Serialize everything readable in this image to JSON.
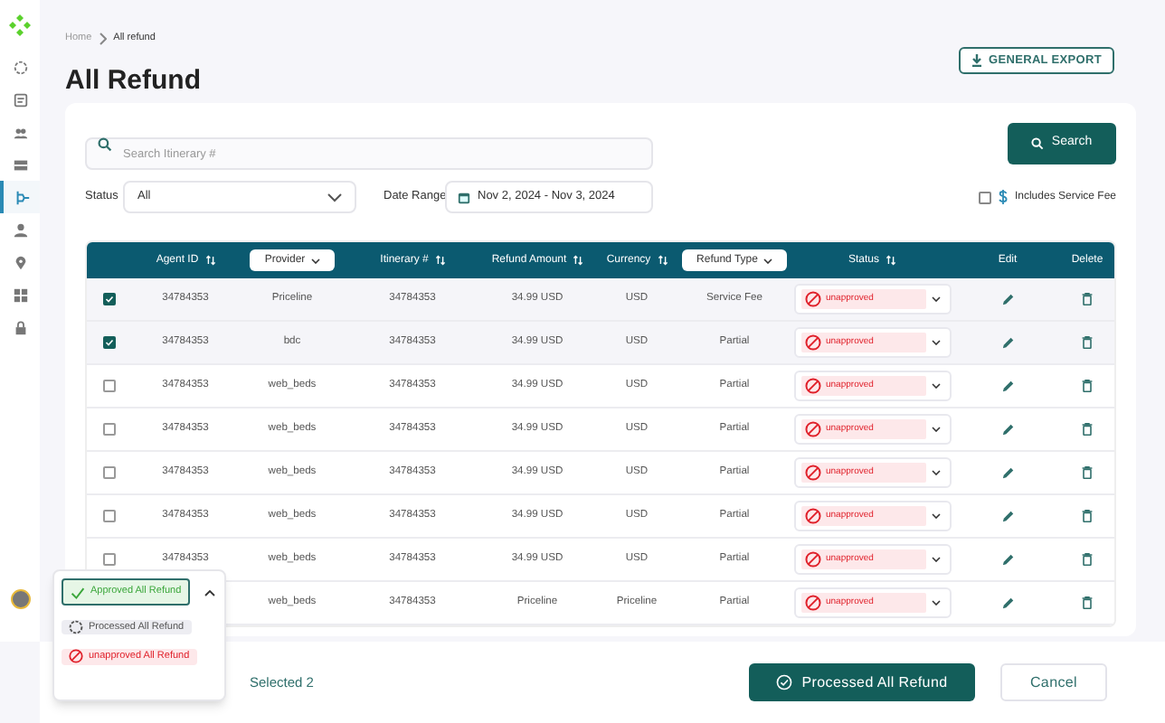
{
  "sidebar": {
    "items": [
      {
        "selected": false
      },
      {
        "selected": false
      },
      {
        "selected": false
      },
      {
        "selected": false
      },
      {
        "selected": true
      },
      {
        "selected": false
      },
      {
        "selected": false
      },
      {
        "selected": false
      },
      {
        "selected": false
      }
    ]
  },
  "breadcrumb": [
    {
      "label": "Home"
    },
    {
      "label": "All refund"
    }
  ],
  "page_title": "All Refund",
  "export_button": "GENERAL EXPORT",
  "filters": {
    "search": {
      "placeholder": "Search Itinerary #"
    },
    "search_button": "Search",
    "status_label": "Status",
    "status_value": "All",
    "date_label": "Date Range",
    "date_value": "Nov 2, 2024 - Nov 3, 2024",
    "service_fee": {
      "label": "Includes Service Fee",
      "checked": false
    }
  },
  "table": {
    "columns": [
      {
        "label": "Agent ID",
        "kind": "sort"
      },
      {
        "label": "Provider",
        "kind": "filter"
      },
      {
        "label": "Itinerary #",
        "kind": "sort"
      },
      {
        "label": "Refund Amount",
        "kind": "sort"
      },
      {
        "label": "Currency",
        "kind": "sort"
      },
      {
        "label": "Refund Type",
        "kind": "filter"
      },
      {
        "label": "Status",
        "kind": "sort"
      },
      {
        "label": "Edit",
        "kind": "plain"
      },
      {
        "label": "Delete",
        "kind": "plain"
      }
    ],
    "rows": [
      {
        "checked": true,
        "agent_id": "34784353",
        "provider": "Priceline",
        "itinerary": "34784353",
        "refund_amount": "34.99 USD",
        "currency": "USD",
        "refund_type": "Service Fee",
        "status": {
          "label": "unapproved",
          "kind": "unapproved"
        }
      },
      {
        "checked": true,
        "agent_id": "34784353",
        "provider": "bdc",
        "itinerary": "34784353",
        "refund_amount": "34.99 USD",
        "currency": "USD",
        "refund_type": "Partial",
        "status": {
          "label": "unapproved",
          "kind": "unapproved"
        }
      },
      {
        "checked": false,
        "agent_id": "34784353",
        "provider": "web_beds",
        "itinerary": "34784353",
        "refund_amount": "34.99 USD",
        "currency": "USD",
        "refund_type": "Partial",
        "status": {
          "label": "unapproved",
          "kind": "unapproved"
        }
      },
      {
        "checked": false,
        "agent_id": "34784353",
        "provider": "web_beds",
        "itinerary": "34784353",
        "refund_amount": "34.99 USD",
        "currency": "USD",
        "refund_type": "Partial",
        "status": {
          "label": "unapproved",
          "kind": "unapproved"
        }
      },
      {
        "checked": false,
        "agent_id": "34784353",
        "provider": "web_beds",
        "itinerary": "34784353",
        "refund_amount": "34.99 USD",
        "currency": "USD",
        "refund_type": "Partial",
        "status": {
          "label": "unapproved",
          "kind": "unapproved"
        }
      },
      {
        "checked": false,
        "agent_id": "34784353",
        "provider": "web_beds",
        "itinerary": "34784353",
        "refund_amount": "34.99 USD",
        "currency": "USD",
        "refund_type": "Partial",
        "status": {
          "label": "unapproved",
          "kind": "unapproved"
        }
      },
      {
        "checked": false,
        "agent_id": "34784353",
        "provider": "web_beds",
        "itinerary": "34784353",
        "refund_amount": "34.99 USD",
        "currency": "USD",
        "refund_type": "Partial",
        "status": {
          "label": "unapproved",
          "kind": "unapproved"
        }
      },
      {
        "provider": "web_beds",
        "itinerary": "34784353",
        "refund_amount": "Priceline",
        "currency": "Priceline",
        "refund_type": "Partial",
        "status": {
          "label": "unapproved",
          "kind": "unapproved"
        }
      }
    ]
  },
  "footer": {
    "selected_count": "Selected 2",
    "primary_button": "Processed All Refund",
    "cancel_button": "Cancel"
  },
  "status_menu": {
    "expanded": true,
    "options": [
      {
        "label": "Approved All Refund",
        "kind": "approved",
        "selected": true
      },
      {
        "label": "Processed All Refund",
        "kind": "processed",
        "selected": false
      },
      {
        "label": "unapproved All Refund",
        "kind": "unapproved",
        "selected": false
      }
    ]
  }
}
